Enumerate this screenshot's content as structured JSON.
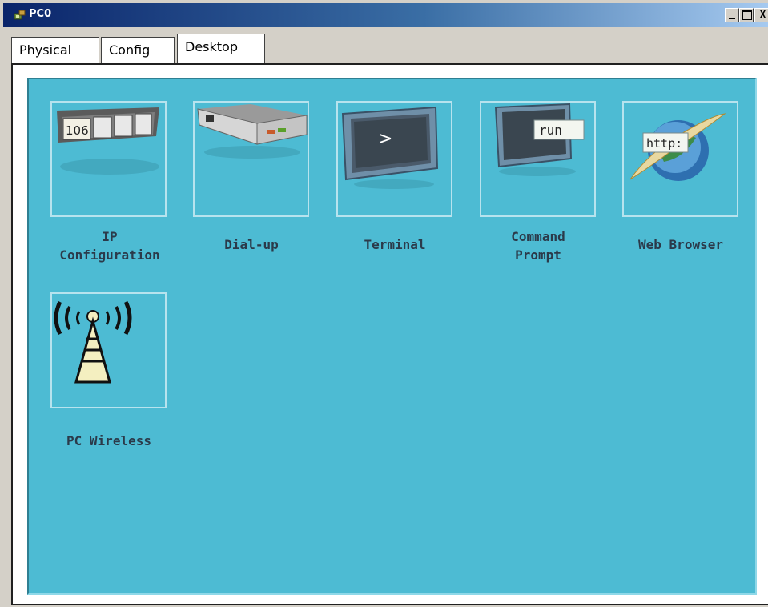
{
  "window": {
    "title": "PC0",
    "buttons": {
      "minimize": "_",
      "maximize": "□",
      "close": "X"
    }
  },
  "tabs": [
    {
      "label": "Physical"
    },
    {
      "label": "Config"
    },
    {
      "label": "Desktop"
    }
  ],
  "active_tab": "Desktop",
  "desktop": {
    "background_color": "#4dbbd3",
    "apps": [
      {
        "label_line1": "IP",
        "label_line2": "Configuration",
        "icon": "ip-configuration-icon",
        "icon_text": "106"
      },
      {
        "label_line1": "Dial-up",
        "icon": "dial-up-modem-icon"
      },
      {
        "label_line1": "Terminal",
        "icon": "terminal-icon",
        "icon_text": ">"
      },
      {
        "label_line1": "Command",
        "label_line2": "Prompt",
        "icon": "command-prompt-icon",
        "icon_text": "run"
      },
      {
        "label_line1": "Web Browser",
        "icon": "web-browser-icon",
        "icon_text": "http:"
      },
      {
        "label_line1": "PC Wireless",
        "icon": "wireless-tower-icon"
      }
    ]
  }
}
